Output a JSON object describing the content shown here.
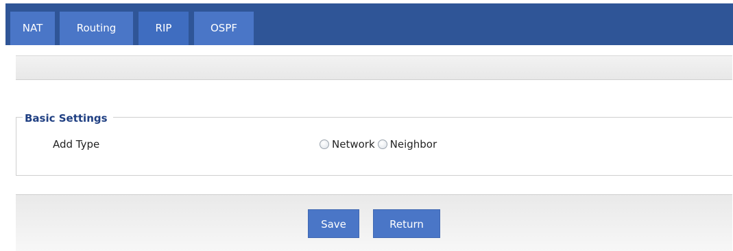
{
  "tabs": [
    {
      "label": "NAT",
      "active": false
    },
    {
      "label": "Routing",
      "active": false
    },
    {
      "label": "RIP",
      "active": true
    },
    {
      "label": "OSPF",
      "active": false
    }
  ],
  "basic_settings": {
    "legend": "Basic Settings",
    "add_type": {
      "label": "Add Type",
      "options": [
        {
          "label": "Network",
          "selected": false
        },
        {
          "label": "Neighbor",
          "selected": false
        }
      ]
    }
  },
  "buttons": {
    "save_label": "Save",
    "return_label": "Return"
  },
  "colors": {
    "tabbar_bg": "#2f5597",
    "tab_bg": "#4a76c7",
    "legend_text": "#1f3f82",
    "button_bg": "#4a76c7"
  }
}
